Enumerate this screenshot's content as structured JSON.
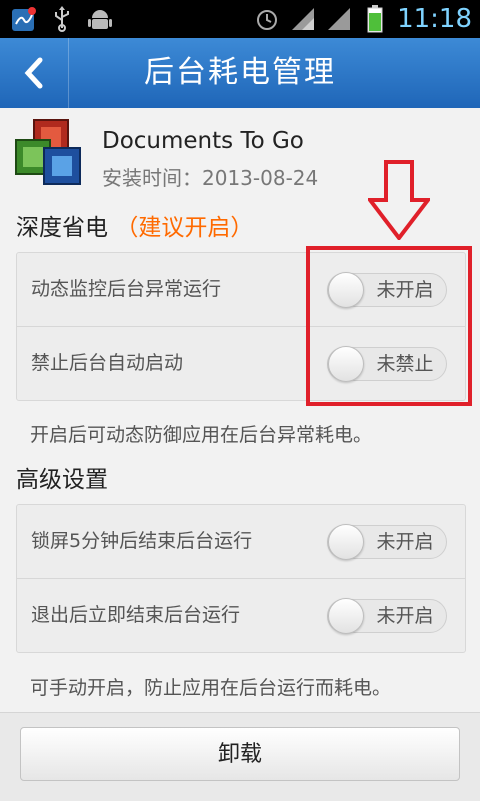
{
  "statusbar": {
    "time": "11:18",
    "icons": [
      "app-notification-icon",
      "usb-icon",
      "android-debug-icon",
      "alarm-icon",
      "wifi-icon",
      "signal-icon",
      "battery-icon"
    ]
  },
  "titlebar": {
    "title": "后台耗电管理",
    "back_icon": "back-icon"
  },
  "app": {
    "name": "Documents To Go",
    "install_time": "安装时间：2013-08-24"
  },
  "section_deep": {
    "title": "深度省电",
    "hint": "（建议开启）",
    "rows": [
      {
        "label": "动态监控后台异常运行",
        "state": "未开启"
      },
      {
        "label": "禁止后台自动启动",
        "state": "未禁止"
      }
    ],
    "note": "开启后可动态防御应用在后台异常耗电。"
  },
  "section_advanced": {
    "title": "高级设置",
    "rows": [
      {
        "label": "锁屏5分钟后结束后台运行",
        "state": "未开启"
      },
      {
        "label": "退出后立即结束后台运行",
        "state": "未开启"
      }
    ],
    "note": "可手动开启，防止应用在后台运行而耗电。"
  },
  "bottom": {
    "uninstall_label": "卸载"
  },
  "colors": {
    "title_bar": "#2f7bc8",
    "hint": "#ff6a00",
    "annotation": "#e0202a"
  }
}
